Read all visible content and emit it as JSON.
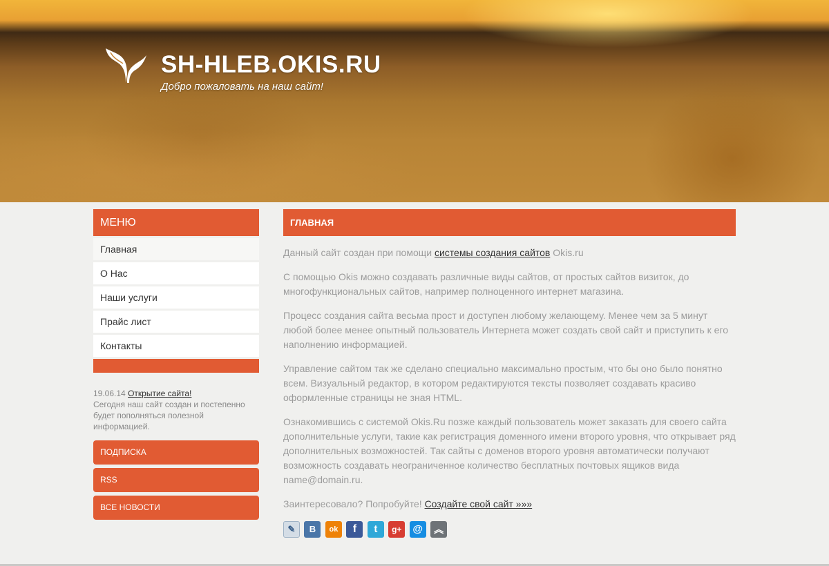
{
  "header": {
    "title": "SH-HLEB.OKIS.RU",
    "slogan": "Добро пожаловать на наш сайт!"
  },
  "sidebar": {
    "menu_title": "МЕНЮ",
    "items": [
      {
        "label": "Главная"
      },
      {
        "label": "О Нас"
      },
      {
        "label": "Наши услуги"
      },
      {
        "label": "Прайс лист"
      },
      {
        "label": "Контакты"
      }
    ],
    "news": {
      "date": "19.06.14",
      "title": "Открытие сайта!",
      "text": "Сегодня наш сайт создан и постепенно будет пополняться полезной информацией."
    },
    "buttons": {
      "subscribe": "ПОДПИСКА",
      "rss": "RSS",
      "all_news": "ВСЕ НОВОСТИ"
    }
  },
  "content": {
    "heading": "ГЛАВНАЯ",
    "p1_before": "Данный сайт создан при помощи ",
    "p1_link": "системы создания сайтов",
    "p1_after": " Okis.ru",
    "p2": "С помощью Okis можно создавать различные виды сайтов, от простых сайтов визиток, до многофункциональных сайтов, например полноценного интернет магазина.",
    "p3": "Процесс создания сайта весьма прост и доступен любому желающему. Менее чем за 5 минут любой более менее опытный пользователь Интернета может создать свой сайт и приступить к его наполнению информацией.",
    "p4": "Управление сайтом так же сделано специально максимально простым, что бы оно было понятно всем. Визуальный редактор, в котором редактируются тексты позволяет создавать красиво оформленные страницы не зная HTML.",
    "p5": "Ознакомившись с системой Okis.Ru позже каждый пользователь может заказать для своего сайта дополнительные услуги, такие как регистрация доменного имени второго уровня, что открывает ряд дополнительных возможностей. Так сайты с доменов второго уровня автоматически получают возможность создавать неограниченное количество бесплатных почтовых ящиков вида name@domain.ru.",
    "p6_before": "Заинтересовало? Попробуйте! ",
    "p6_link": "Создайте свой сайт »»»"
  },
  "social": [
    {
      "icon": "livejournal-icon",
      "glyph": "✎",
      "color": "#d4dde6"
    },
    {
      "icon": "vkontakte-icon",
      "glyph": "B",
      "color": "#4a76a8"
    },
    {
      "icon": "odnoklassniki-icon",
      "glyph": "ok",
      "color": "#ee8208"
    },
    {
      "icon": "facebook-icon",
      "glyph": "f",
      "color": "#3b5998"
    },
    {
      "icon": "twitter-icon",
      "glyph": "t",
      "color": "#2fa8d8"
    },
    {
      "icon": "googleplus-icon",
      "glyph": "g+",
      "color": "#d73d32"
    },
    {
      "icon": "mailru-icon",
      "glyph": "@",
      "color": "#168de2"
    },
    {
      "icon": "bookmark-up-icon",
      "glyph": "︽",
      "color": "#6e7377"
    }
  ],
  "colors": {
    "accent": "#e15b33",
    "page_bg": "#f0f0ee",
    "text_muted": "#9c9c9c"
  }
}
